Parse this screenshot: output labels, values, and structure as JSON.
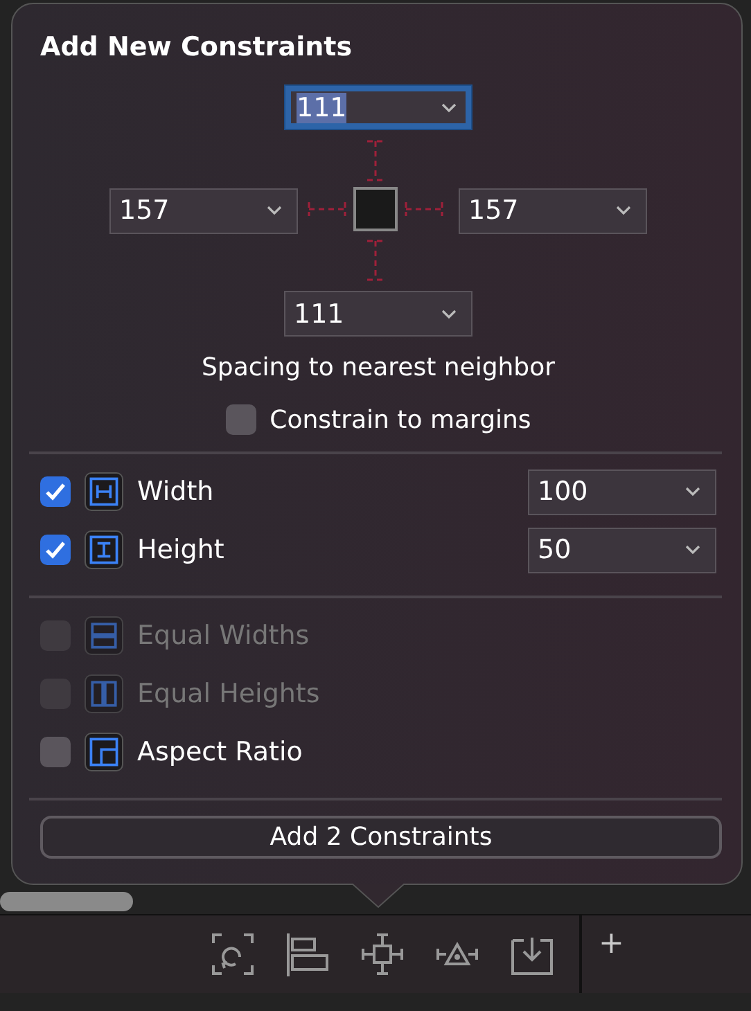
{
  "popover": {
    "title": "Add New Constraints",
    "spacing": {
      "top": {
        "value": "111",
        "focused": true
      },
      "left": {
        "value": "157",
        "focused": false
      },
      "right": {
        "value": "157",
        "focused": false
      },
      "bottom": {
        "value": "111",
        "focused": false
      }
    },
    "spacing_label": "Spacing to nearest neighbor",
    "constrain_to_margins": {
      "label": "Constrain to margins",
      "checked": false
    },
    "size_constraints": [
      {
        "kind": "width",
        "label": "Width",
        "checked": true,
        "disabled": false,
        "value": "100"
      },
      {
        "kind": "height",
        "label": "Height",
        "checked": true,
        "disabled": false,
        "value": "50"
      }
    ],
    "relation_constraints": [
      {
        "kind": "equal-widths",
        "label": "Equal Widths",
        "checked": false,
        "disabled": true
      },
      {
        "kind": "equal-heights",
        "label": "Equal Heights",
        "checked": false,
        "disabled": true
      },
      {
        "kind": "aspect-ratio",
        "label": "Aspect Ratio",
        "checked": false,
        "disabled": false
      }
    ],
    "add_button": "Add 2 Constraints"
  },
  "side_panel": {
    "add_label": "+"
  }
}
